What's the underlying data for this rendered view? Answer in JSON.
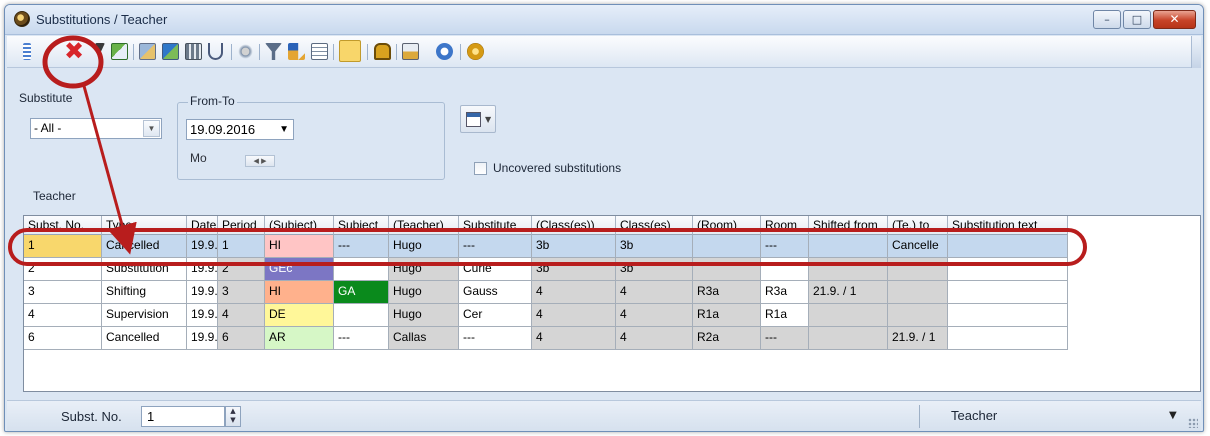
{
  "window": {
    "title": "Substitutions / Teacher",
    "buttons": {
      "minimize": "–",
      "maximize": "□",
      "close": "✕"
    }
  },
  "toolbar": {
    "icons": [
      "grid-icon",
      "delete-icon",
      "filter-small-icon",
      "export-icon",
      "copy-icon",
      "import-icon",
      "calculator-icon",
      "stethoscope-icon",
      "satellite-icon",
      "filter-icon",
      "sort-icon",
      "list-icon",
      "edit-active-icon",
      "lock-icon",
      "print-icon",
      "refresh-icon",
      "settings-icon"
    ],
    "delete_glyph": "✖"
  },
  "filters": {
    "substitute_label": "Substitute",
    "substitute_value": "- All -",
    "from_to_label": "From-To",
    "date_value": "19.09.2016",
    "weekday": "Mo",
    "uncovered_label": "Uncovered substitutions",
    "teacher_label": "Teacher"
  },
  "table": {
    "columns": [
      "Subst. No.",
      "Type",
      "Date",
      "Period",
      "(Subject)",
      "Subject",
      "(Teacher)",
      "Substitute",
      "(Class(es))",
      "Class(es)",
      "(Room)",
      "Room",
      "Shifted from",
      "(Te.) to",
      "Substitution text"
    ],
    "rows": [
      [
        "1",
        "Cancelled",
        "19.9.",
        "1",
        "HI",
        "---",
        "Hugo",
        "---",
        "3b",
        "3b",
        "",
        "---",
        "",
        "Cancelle",
        ""
      ],
      [
        "2",
        "Substitution",
        "19.9.",
        "2",
        "GEc",
        "",
        "Hugo",
        "Curie",
        "3b",
        "3b",
        "",
        "",
        "",
        "",
        ""
      ],
      [
        "3",
        "Shifting",
        "19.9.",
        "3",
        "HI",
        "GA",
        "Hugo",
        "Gauss",
        "4",
        "4",
        "R3a",
        "R3a",
        "21.9. / 1",
        "",
        ""
      ],
      [
        "4",
        "Supervision",
        "19.9.",
        "4",
        "DE",
        "",
        "Hugo",
        "Cer",
        "4",
        "4",
        "R1a",
        "R1a",
        "",
        "",
        ""
      ],
      [
        "6",
        "Cancelled",
        "19.9.",
        "6",
        "AR",
        "---",
        "Callas",
        "---",
        "4",
        "4",
        "R2a",
        "---",
        "",
        "21.9. / 1",
        ""
      ]
    ]
  },
  "status": {
    "subst_no_label": "Subst. No.",
    "subst_no_value": "1",
    "view_value": "Teacher"
  },
  "colors": {
    "annotation": "#b81d1d",
    "hi": "#ffb18c",
    "gec": "#7c76c4",
    "ga": "#0a8a1c",
    "de": "#fff799",
    "ar": "#d6f7c6",
    "cancelled_hi": "#ffc5c5"
  }
}
